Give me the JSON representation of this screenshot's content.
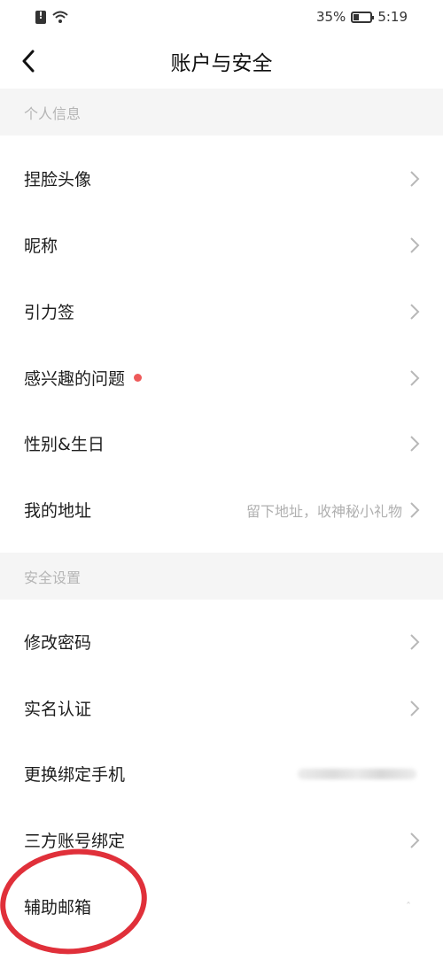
{
  "status_bar": {
    "battery": "35%",
    "battery_level": 0.35,
    "time": "5:19"
  },
  "header": {
    "title": "账户与安全"
  },
  "sections": {
    "personal": {
      "title": "个人信息",
      "items": [
        {
          "label": "捏脸头像"
        },
        {
          "label": "昵称"
        },
        {
          "label": "引力签"
        },
        {
          "label": "感兴趣的问题",
          "badge_color": "#ee5a5a"
        },
        {
          "label": "性别&生日"
        },
        {
          "label": "我的地址",
          "hint": "留下地址，收神秘小礼物"
        }
      ]
    },
    "security": {
      "title": "安全设置",
      "items": [
        {
          "label": "修改密码"
        },
        {
          "label": "实名认证"
        },
        {
          "label": "更换绑定手机"
        },
        {
          "label": "三方账号绑定"
        },
        {
          "label": "辅助邮箱",
          "mark": "ˆ"
        }
      ]
    }
  },
  "colors": {
    "annotation": "#e0303a",
    "section_bg": "#f5f5f5"
  }
}
